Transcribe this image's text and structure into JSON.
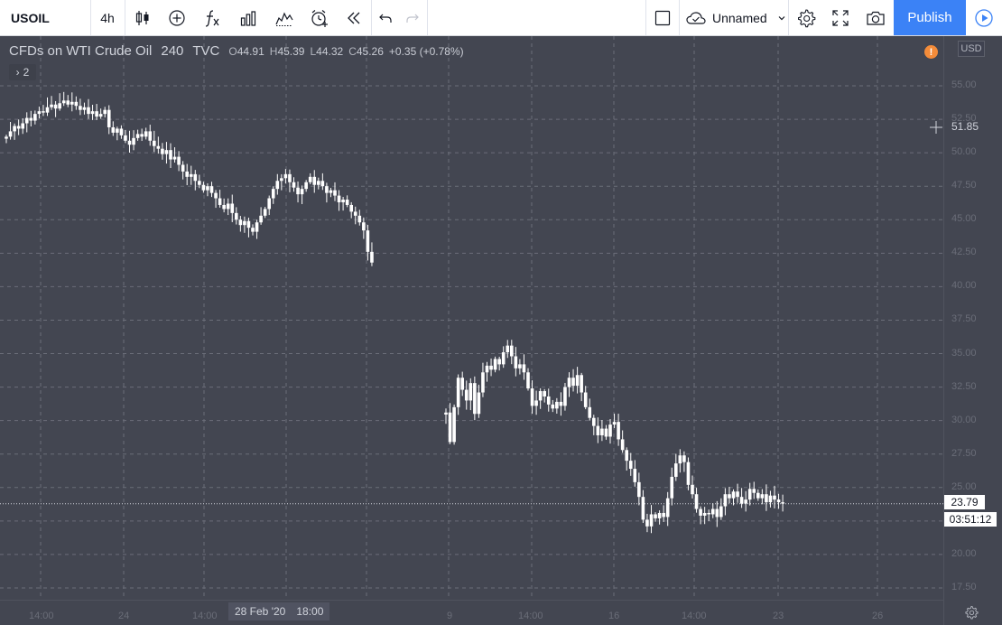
{
  "toolbar": {
    "symbol": "USOIL",
    "interval": "4h",
    "icons": [
      "bar-style-icon",
      "compare-add-icon",
      "indicators-fx-icon",
      "financials-icon",
      "templates-icon",
      "alert-icon",
      "replay-icon",
      "undo-icon",
      "redo-icon",
      "fullscreen-layout-icon",
      "cloud-icon",
      "chevron-down-icon",
      "settings-gear-icon",
      "fullscreen-icon",
      "camera-icon",
      "play-icon"
    ],
    "layout_name": "Unnamed",
    "publish_label": "Publish"
  },
  "legend": {
    "symbol_name": "CFDs on WTI Crude Oil",
    "interval": "240",
    "source": "TVC",
    "o_key": "O",
    "o_val": "44.91",
    "h_key": "H",
    "h_val": "45.39",
    "l_key": "L",
    "l_val": "44.32",
    "c_key": "C",
    "c_val": "45.26",
    "change": "+0.35 (+0.78%)",
    "indicator_count": "2",
    "warn_symbol": "!",
    "currency": "USD"
  },
  "price_axis": {
    "labels": [
      "55.00",
      "52.50",
      "50.00",
      "47.50",
      "45.00",
      "42.50",
      "40.00",
      "37.50",
      "35.00",
      "32.50",
      "30.00",
      "27.50",
      "25.00",
      "22.50",
      "20.00",
      "17.50"
    ],
    "cursor_price": "51.85",
    "last_price": "23.79",
    "countdown": "03:51:12"
  },
  "time_axis": {
    "labels": [
      "14:00",
      "24",
      "14:00",
      "9",
      "14:00",
      "16",
      "14:00",
      "23",
      "26"
    ],
    "highlight_date": "28 Feb '20",
    "highlight_time": "18:00"
  },
  "colors": {
    "background": "#434651",
    "candle": "#ffffff",
    "grid": "#6b6e79",
    "publish": "#3b82f6"
  },
  "chart_data": {
    "type": "candlestick",
    "symbol": "USOIL",
    "ylim": [
      16.5,
      56.5
    ],
    "series": [
      {
        "segment": 1,
        "close": [
          51.2,
          51.6,
          52.0,
          51.8,
          52.2,
          52.6,
          52.4,
          52.9,
          53.1,
          53.0,
          53.4,
          53.6,
          53.3,
          53.7,
          53.9,
          53.6,
          53.8,
          53.5,
          53.2,
          53.4,
          52.9,
          53.1,
          52.7,
          52.9,
          53.2,
          51.9,
          51.5,
          51.8,
          51.3,
          50.9,
          50.6,
          51.1,
          51.4,
          51.2,
          51.6,
          50.9,
          50.5,
          50.3,
          49.9,
          50.2,
          49.5,
          49.7,
          49.1,
          48.6,
          48.2,
          48.4,
          47.9,
          47.6,
          47.2,
          47.5,
          47.0,
          46.6,
          46.1,
          45.8,
          46.2,
          45.5,
          45.0,
          44.6,
          44.9,
          44.4,
          44.1,
          44.8,
          45.3,
          45.8,
          46.6,
          47.3,
          47.9,
          48.1,
          48.4,
          47.8,
          47.4,
          46.9,
          47.3,
          47.8,
          48.2,
          47.6,
          47.9,
          47.5,
          47.0,
          47.2,
          46.8,
          46.3,
          46.5,
          46.1,
          45.6,
          45.3,
          44.8,
          44.2,
          42.6,
          41.8
        ]
      },
      {
        "segment": 2,
        "close": [
          30.6,
          28.4,
          31.0,
          33.2,
          32.3,
          31.5,
          32.8,
          30.5,
          32.1,
          33.6,
          34.1,
          33.8,
          34.6,
          34.2,
          35.1,
          35.6,
          34.8,
          33.9,
          34.2,
          33.6,
          32.4,
          31.1,
          31.5,
          32.2,
          31.8,
          31.2,
          30.9,
          31.4,
          31.1,
          32.5,
          33.2,
          32.6,
          33.4,
          32.1,
          31.0,
          30.2,
          29.6,
          28.9,
          29.4,
          28.8,
          29.7,
          29.9,
          28.6,
          27.8,
          27.0,
          26.4,
          25.4,
          24.3,
          22.6,
          22.1,
          23.0,
          22.7,
          23.1,
          22.8,
          24.2,
          25.8,
          26.8,
          27.4,
          26.9,
          25.2,
          24.5,
          23.4,
          22.9,
          23.1,
          23.0,
          23.4,
          22.8,
          23.6,
          24.5,
          24.2,
          24.7,
          24.3,
          23.8,
          24.1,
          24.9,
          24.6,
          24.2,
          24.5,
          23.9,
          24.4,
          24.1,
          23.9,
          23.8
        ]
      }
    ]
  }
}
